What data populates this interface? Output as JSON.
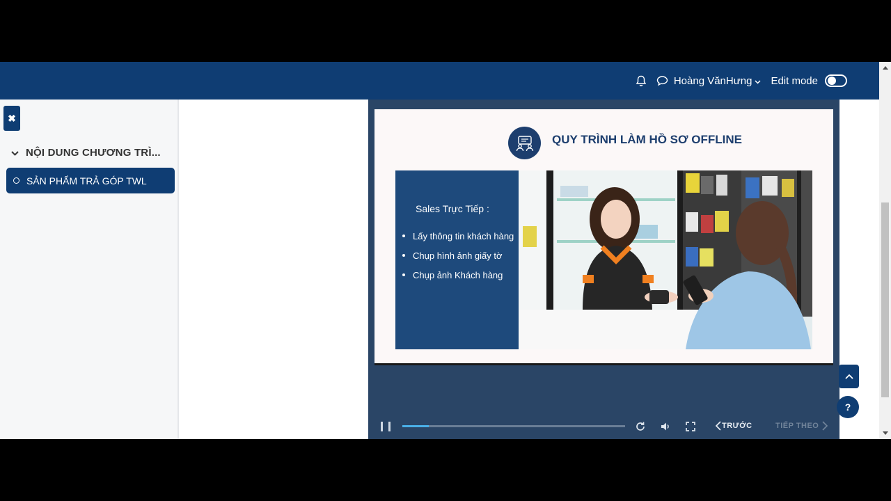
{
  "navbar": {
    "bell_icon": "bell-icon",
    "chat_icon": "chat-icon",
    "user_name": "Hoàng VănHưng",
    "edit_mode_label": "Edit mode",
    "edit_mode_on": false
  },
  "sidebar": {
    "close_icon": "close-icon",
    "section_title": "NỘI DUNG CHƯƠNG TRÌ...",
    "items": [
      {
        "label": "SẢN PHẨM TRẢ GÓP TWL",
        "active": true
      }
    ]
  },
  "slide": {
    "title": "QUY TRÌNH LÀM HỒ SƠ OFFLINE",
    "panel_title": "Sales Trực Tiếp :",
    "bullets": [
      "Lấy thông tin khách hàng",
      "Chụp hình ảnh giấy tờ",
      "Chụp ảnh Khách hàng"
    ]
  },
  "player": {
    "progress": 0.12,
    "prev_label": "TRƯỚC",
    "next_label": "TIẾP THEO"
  },
  "help_label": "?",
  "colors": {
    "brand": "#0f3d73",
    "player_bg": "#2a4566",
    "panel": "#1e4a7c",
    "progress": "#4ab0e8"
  }
}
